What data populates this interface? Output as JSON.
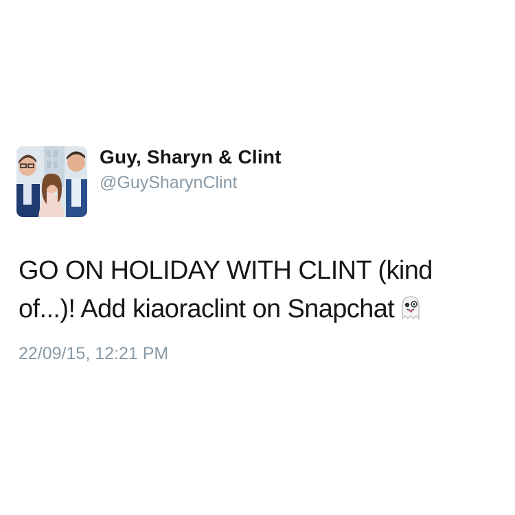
{
  "tweet": {
    "display_name": "Guy, Sharyn & Clint",
    "handle": "@GuySharynClint",
    "text_line_1": "GO ON HOLIDAY WITH CLINT (kind",
    "text_line_2": "of...)! Add kiaoraclint on Snapchat",
    "emoji": "ghost-emoji",
    "timestamp": "22/09/15, 12:21 PM"
  },
  "colors": {
    "text": "#14171a",
    "muted": "#8899a6",
    "background": "#ffffff"
  }
}
